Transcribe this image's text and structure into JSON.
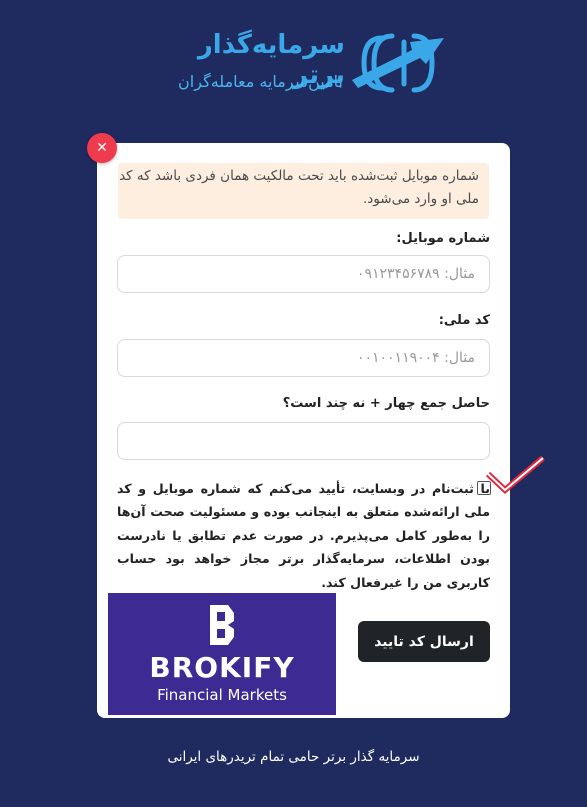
{
  "brand": {
    "name": "سرمایه‌گذار برتر",
    "tagline": "تامین‌سرمایه معامله‌گران",
    "color": "#3aa8e8"
  },
  "form": {
    "notice": "شماره موبایل ثبت‌شده باید تحت مالکیت همان فردی باشد که کد ملی او وارد می‌شود.",
    "mobile_label": "شماره موبایل:",
    "mobile_placeholder": "مثال: ۰۹۱۲۳۴۵۶۷۸۹",
    "national_id_label": "کد ملی:",
    "national_id_placeholder": "مثال: ۰۰۱۰۰۱۱۹۰۰۴",
    "captcha_label": "حاصل جمع چهار + نه چند است؟",
    "captcha_value": "",
    "agreement_text": "با ثبت‌نام در وبسایت، تأیید می‌کنم که شماره موبایل و کد ملی ارائه‌شده متعلق به اینجانب بوده و مسئولیت صحت آن‌ها را به‌طور کامل می‌پذیرم. در صورت عدم تطابق یا نادرست بودن اطلاعات، سرمایه‌گذار برتر مجاز خواهد بود حساب کاربری من را غیرفعال کند.",
    "agreement_checked": false,
    "submit_label": "ارسال کد تایید"
  },
  "banner": {
    "name": "BROKIFY",
    "subtitle": "Financial Markets",
    "background": "#3d2a92"
  },
  "footer": {
    "text": "سرمایه گذار برتر حامی تمام تریدرهای ایرانی"
  },
  "colors": {
    "page_bg": "#1f2a5f",
    "close_button": "#ee3c4e",
    "check_mark": "#e0283c"
  }
}
